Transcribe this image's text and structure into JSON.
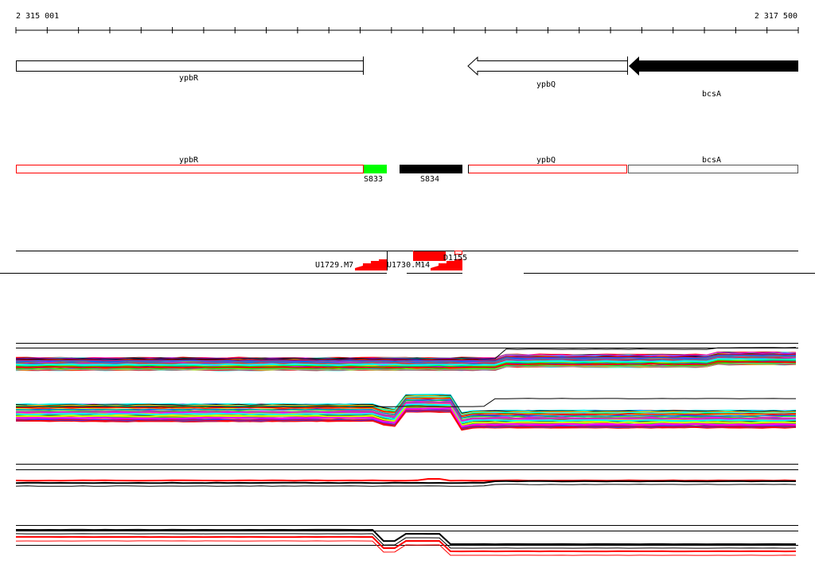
{
  "ruler": {
    "start_label": "2 315 001",
    "end_label": "2 317 500",
    "tick_count": 25
  },
  "genes": [
    {
      "name": "ypbR",
      "strand": "none",
      "fill": "#ffffff"
    },
    {
      "name": "ypbQ",
      "strand": "reverse",
      "fill": "#ffffff"
    },
    {
      "name": "bcsA",
      "strand": "reverse",
      "fill": "#000000"
    }
  ],
  "segments": [
    {
      "name": "ypbR"
    },
    {
      "name": "S833",
      "color": "#00ff00"
    },
    {
      "name": "S834",
      "color": "#000000"
    },
    {
      "name": "ypbQ"
    },
    {
      "name": "bcsA"
    }
  ],
  "features": [
    {
      "name": "U1729.M7"
    },
    {
      "name": "U1730.M14"
    },
    {
      "name": "D1155"
    }
  ],
  "colors": {
    "accent": "#ff0000",
    "palette": [
      "#ff0000",
      "#ff00ff",
      "#00ffff",
      "#0066ff",
      "#00ff00",
      "#ccff00",
      "#999999",
      "#996666",
      "#000000",
      "#ffcc00",
      "#3333ff"
    ]
  }
}
